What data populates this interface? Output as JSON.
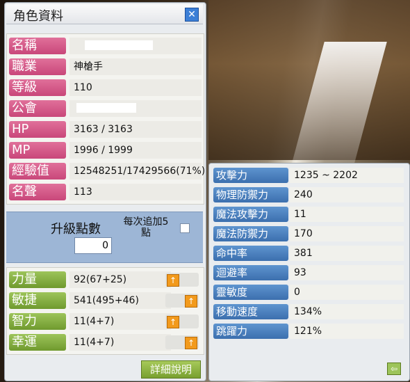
{
  "window": {
    "title": "角色資料"
  },
  "info": [
    {
      "label": "名稱",
      "value": "",
      "masked": true
    },
    {
      "label": "職業",
      "value": "神槍手"
    },
    {
      "label": "等級",
      "value": "110"
    },
    {
      "label": "公會",
      "value": "",
      "masked": true
    },
    {
      "label": "HP",
      "value": "3163 / 3163"
    },
    {
      "label": "MP",
      "value": "1996 / 1999"
    },
    {
      "label": "經驗值",
      "value": "12548251/17429566(71%)"
    },
    {
      "label": "名聲",
      "value": "113"
    }
  ],
  "points": {
    "label": "升級點數",
    "value": "0",
    "auto_label": "每次追加5點"
  },
  "stats": [
    {
      "label": "力量",
      "value": "92(67+25)"
    },
    {
      "label": "敏捷",
      "value": "541(495+46)"
    },
    {
      "label": "智力",
      "value": "11(4+7)"
    },
    {
      "label": "幸運",
      "value": "11(4+7)"
    }
  ],
  "detail_button": "詳細說明",
  "details": [
    {
      "label": "攻擊力",
      "value": "1235 ~ 2202"
    },
    {
      "label": "物理防禦力",
      "value": "240"
    },
    {
      "label": "魔法攻擊力",
      "value": "11"
    },
    {
      "label": "魔法防禦力",
      "value": "170"
    },
    {
      "label": "命中率",
      "value": "381"
    },
    {
      "label": "迴避率",
      "value": "93"
    },
    {
      "label": "靈敏度",
      "value": "0"
    },
    {
      "label": "移動速度",
      "value": "134%"
    },
    {
      "label": "跳躍力",
      "value": "121%"
    }
  ],
  "icons": {
    "close": "close-icon",
    "up": "up-arrow-icon",
    "back": "back-arrow-icon"
  }
}
